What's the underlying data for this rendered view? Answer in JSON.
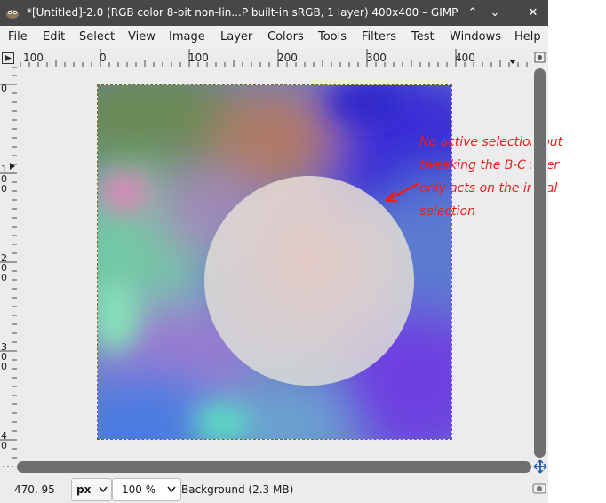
{
  "window": {
    "title": "*[Untitled]-2.0 (RGB color 8-bit non-lin...P built-in sRGB, 1 layer) 400x400 – GIMP",
    "buttons": [
      "⌃",
      "⌄",
      "✕"
    ]
  },
  "menu": [
    "File",
    "Edit",
    "Select",
    "View",
    "Image",
    "Layer",
    "Colors",
    "Tools",
    "Filters",
    "Test",
    "Windows",
    "Help"
  ],
  "rulers": {
    "horizontal": [
      "100",
      "0",
      "100",
      "200",
      "300",
      "400"
    ],
    "vertical": [
      "0",
      "1\n0\n0",
      "2\n0\n0",
      "3\n0\n0",
      "4\n0"
    ]
  },
  "annotation": {
    "lines": [
      "No active selection but",
      "tweaking the B-C filter",
      "only acts on the initial",
      "selection"
    ],
    "color": "#e8211f"
  },
  "status": {
    "coords": "470, 95",
    "unit": "px",
    "zoom": "100 %",
    "layer": "Background (2.3 MB)"
  }
}
